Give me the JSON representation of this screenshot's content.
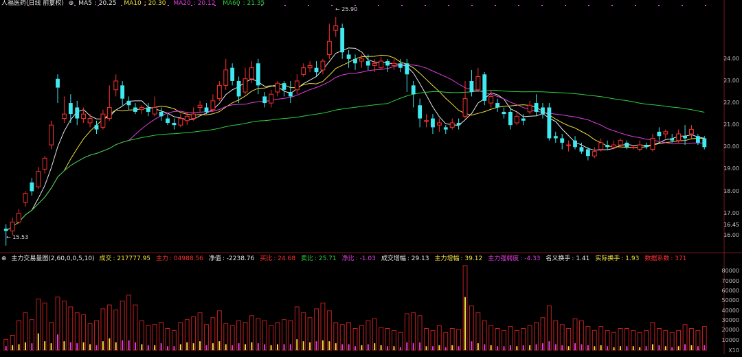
{
  "header": {
    "stock_name": "人福医药(日线 前复权)",
    "ma": [
      {
        "label": "MA5",
        "value": "20.25",
        "color": "#e8e8e8"
      },
      {
        "label": "MA10",
        "value": "20.30",
        "color": "#f0e040"
      },
      {
        "label": "MA20",
        "value": "20.12",
        "color": "#e040e0"
      },
      {
        "label": "MA60",
        "value": "21.35",
        "color": "#30d040"
      }
    ]
  },
  "indicator": {
    "title": "主力交易量图(2,60,0,0,5,10)",
    "items": [
      {
        "label": "成交",
        "value": "217777.95",
        "color": "#f0e040"
      },
      {
        "label": "主力",
        "value": "04988.56",
        "color": "#ff3030"
      },
      {
        "label": "净值",
        "value": "-2238.76",
        "color": "#e8e8e8"
      },
      {
        "label": "买比",
        "value": "24.68",
        "color": "#ff3030"
      },
      {
        "label": "卖比",
        "value": "25.71",
        "color": "#30d040"
      },
      {
        "label": "净比",
        "value": "-1.03",
        "color": "#e040e0"
      },
      {
        "label": "成交增幅",
        "value": "29.13",
        "color": "#e8e8e8"
      },
      {
        "label": "主力增幅",
        "value": "39.12",
        "color": "#f0e040"
      },
      {
        "label": "主力强弱度",
        "value": "-4.33",
        "color": "#e040e0"
      },
      {
        "label": "名义换手",
        "value": "1.41",
        "color": "#e8e8e8"
      },
      {
        "label": "实际换手",
        "value": "1.93",
        "color": "#f0e040"
      },
      {
        "label": "数据系数",
        "value": "371",
        "color": "#ff3030"
      }
    ]
  },
  "price_axis": {
    "ticks": [
      "24.00",
      "23.00",
      "22.00",
      "21.00",
      "20.00",
      "19.00",
      "18.00",
      "17.00",
      "16.00"
    ],
    "current": "16.45"
  },
  "volume_axis": {
    "ticks": [
      "80000",
      "70000",
      "60000",
      "50000",
      "40000",
      "30000",
      "20000",
      "10000"
    ],
    "unit": "X10"
  },
  "annotations": {
    "high": "25.90",
    "low": "15.53"
  },
  "chart_data": {
    "type": "candlestick",
    "title": "人福医药(日线 前复权)",
    "ylim": [
      15.4,
      26.3
    ],
    "volume_ylim": [
      0,
      88000
    ],
    "candles": [
      [
        16.3,
        16.2,
        16.5,
        15.53
      ],
      [
        16.2,
        16.6,
        16.8,
        16.0
      ],
      [
        16.6,
        17.0,
        17.2,
        16.5
      ],
      [
        17.5,
        17.9,
        18.0,
        17.3
      ],
      [
        18.4,
        18.0,
        18.6,
        17.8
      ],
      [
        18.2,
        18.9,
        19.1,
        18.1
      ],
      [
        19.0,
        19.5,
        19.6,
        18.8
      ],
      [
        20.1,
        21.0,
        21.2,
        19.9
      ],
      [
        23.1,
        22.7,
        23.3,
        22.0
      ],
      [
        21.3,
        21.5,
        22.3,
        21.1
      ],
      [
        22.0,
        21.5,
        22.4,
        21.1
      ],
      [
        21.8,
        21.3,
        22.1,
        21.0
      ],
      [
        21.3,
        21.5,
        21.8,
        21.1
      ],
      [
        21.1,
        21.3,
        21.5,
        20.9
      ],
      [
        21.0,
        20.8,
        21.2,
        20.6
      ],
      [
        20.9,
        21.5,
        21.7,
        20.8
      ],
      [
        21.3,
        21.8,
        22.8,
        21.2
      ],
      [
        22.6,
        23.0,
        23.3,
        22.3
      ],
      [
        22.8,
        22.2,
        23.0,
        21.9
      ],
      [
        22.1,
        21.9,
        22.3,
        21.7
      ],
      [
        21.8,
        21.6,
        22.0,
        21.5
      ],
      [
        21.7,
        21.8,
        21.9,
        21.5
      ],
      [
        21.8,
        21.6,
        22.0,
        21.4
      ],
      [
        21.5,
        21.8,
        22.3,
        21.4
      ],
      [
        21.6,
        21.4,
        21.8,
        21.2
      ],
      [
        21.3,
        21.1,
        21.5,
        21.0
      ],
      [
        21.1,
        21.0,
        21.3,
        20.8
      ],
      [
        21.0,
        21.3,
        21.5,
        20.9
      ],
      [
        21.2,
        21.4,
        21.6,
        21.0
      ],
      [
        21.3,
        21.5,
        21.8,
        21.2
      ],
      [
        21.8,
        21.9,
        22.1,
        21.6
      ],
      [
        21.8,
        21.6,
        22.0,
        21.5
      ],
      [
        21.7,
        22.1,
        22.4,
        21.6
      ],
      [
        22.2,
        22.8,
        23.0,
        22.1
      ],
      [
        22.8,
        23.5,
        24.0,
        22.6
      ],
      [
        23.6,
        23.0,
        23.8,
        22.8
      ],
      [
        23.0,
        22.3,
        23.2,
        22.0
      ],
      [
        22.5,
        23.1,
        23.6,
        22.4
      ],
      [
        23.1,
        23.6,
        23.9,
        22.9
      ],
      [
        23.8,
        22.8,
        24.0,
        22.4
      ],
      [
        22.3,
        22.0,
        22.5,
        21.8
      ],
      [
        22.0,
        22.4,
        22.6,
        21.8
      ],
      [
        22.5,
        22.9,
        23.0,
        22.3
      ],
      [
        22.9,
        22.6,
        23.0,
        22.3
      ],
      [
        22.5,
        22.3,
        23.0,
        22.0
      ],
      [
        22.6,
        23.0,
        23.3,
        22.4
      ],
      [
        23.3,
        23.6,
        23.8,
        23.2
      ],
      [
        23.6,
        23.7,
        23.9,
        23.4
      ],
      [
        23.6,
        23.4,
        23.9,
        23.2
      ],
      [
        23.5,
        23.9,
        24.0,
        23.3
      ],
      [
        24.2,
        24.8,
        25.6,
        24.0
      ],
      [
        25.3,
        25.5,
        25.9,
        25.0
      ],
      [
        25.4,
        24.3,
        25.6,
        24.0
      ],
      [
        24.2,
        24.0,
        24.4,
        23.6
      ],
      [
        24.0,
        23.8,
        24.2,
        23.5
      ],
      [
        23.9,
        24.0,
        24.2,
        23.6
      ],
      [
        23.9,
        23.7,
        24.2,
        23.5
      ],
      [
        23.7,
        23.8,
        24.0,
        23.4
      ],
      [
        23.6,
        23.9,
        24.1,
        23.5
      ],
      [
        23.9,
        23.7,
        24.0,
        23.4
      ],
      [
        23.7,
        23.8,
        24.0,
        23.5
      ],
      [
        23.8,
        23.6,
        24.0,
        23.4
      ],
      [
        23.8,
        23.3,
        24.0,
        22.5
      ],
      [
        22.8,
        22.4,
        23.0,
        21.8
      ],
      [
        21.9,
        21.3,
        22.2,
        20.9
      ],
      [
        21.2,
        21.2,
        21.5,
        20.9
      ],
      [
        21.3,
        20.9,
        21.5,
        20.6
      ],
      [
        21.0,
        21.1,
        21.3,
        20.7
      ],
      [
        20.9,
        20.8,
        21.0,
        20.6
      ],
      [
        20.9,
        21.1,
        21.3,
        20.8
      ],
      [
        21.1,
        21.0,
        21.3,
        20.8
      ],
      [
        21.4,
        22.2,
        23.0,
        21.3
      ],
      [
        23.0,
        22.5,
        23.5,
        22.3
      ],
      [
        22.6,
        23.2,
        23.6,
        22.5
      ],
      [
        23.3,
        22.1,
        23.4,
        21.9
      ],
      [
        22.0,
        22.3,
        22.6,
        21.8
      ],
      [
        22.0,
        21.8,
        22.2,
        21.6
      ],
      [
        21.6,
        21.5,
        21.8,
        21.3
      ],
      [
        21.6,
        21.0,
        21.8,
        20.8
      ],
      [
        21.1,
        21.4,
        21.6,
        21.0
      ],
      [
        21.3,
        21.2,
        21.5,
        21.0
      ],
      [
        21.6,
        21.9,
        22.1,
        21.5
      ],
      [
        22.0,
        21.6,
        22.4,
        21.4
      ],
      [
        21.8,
        21.5,
        22.0,
        21.3
      ],
      [
        21.8,
        20.4,
        22.0,
        20.3
      ],
      [
        20.5,
        20.4,
        20.7,
        20.2
      ],
      [
        20.4,
        20.2,
        20.6,
        19.9
      ],
      [
        20.1,
        20.1,
        20.3,
        19.8
      ],
      [
        20.3,
        20.0,
        20.5,
        19.9
      ],
      [
        20.0,
        19.8,
        20.2,
        19.7
      ],
      [
        19.9,
        19.6,
        20.0,
        19.4
      ],
      [
        19.6,
        19.8,
        20.0,
        19.5
      ],
      [
        19.9,
        20.2,
        20.4,
        19.8
      ],
      [
        20.1,
        20.0,
        20.3,
        19.9
      ],
      [
        20.0,
        20.1,
        20.3,
        19.9
      ],
      [
        20.1,
        20.3,
        20.4,
        20.0
      ],
      [
        20.2,
        20.0,
        20.3,
        19.9
      ],
      [
        20.0,
        20.0,
        20.1,
        19.9
      ],
      [
        19.9,
        20.1,
        20.3,
        19.8
      ],
      [
        20.1,
        20.0,
        20.2,
        19.9
      ],
      [
        19.9,
        20.4,
        20.6,
        19.8
      ],
      [
        20.7,
        20.5,
        20.9,
        20.3
      ],
      [
        20.6,
        20.7,
        20.8,
        20.4
      ],
      [
        20.4,
        20.3,
        20.6,
        20.2
      ],
      [
        20.3,
        20.6,
        20.8,
        20.2
      ],
      [
        20.5,
        20.4,
        21.0,
        20.1
      ],
      [
        20.6,
        20.8,
        21.0,
        20.4
      ],
      [
        20.5,
        20.2,
        20.6,
        20.1
      ],
      [
        20.4,
        20.0,
        20.5,
        19.9
      ]
    ],
    "volumes": [
      [
        11000,
        4000
      ],
      [
        15000,
        5000
      ],
      [
        30000,
        6000
      ],
      [
        38000,
        8000
      ],
      [
        31000,
        7000
      ],
      [
        52000,
        17000
      ],
      [
        48000,
        9000
      ],
      [
        28000,
        7000
      ],
      [
        54000,
        16000
      ],
      [
        50000,
        9000
      ],
      [
        44000,
        8000
      ],
      [
        38000,
        7000
      ],
      [
        36000,
        8000
      ],
      [
        27000,
        6000
      ],
      [
        30000,
        5000
      ],
      [
        42000,
        9000
      ],
      [
        46000,
        12000
      ],
      [
        41000,
        8000
      ],
      [
        50000,
        10000
      ],
      [
        56000,
        10000
      ],
      [
        46000,
        8000
      ],
      [
        30000,
        6000
      ],
      [
        25000,
        5000
      ],
      [
        26000,
        5000
      ],
      [
        28000,
        7000
      ],
      [
        22000,
        4000
      ],
      [
        20000,
        4000
      ],
      [
        28000,
        6000
      ],
      [
        31000,
        8000
      ],
      [
        34000,
        7000
      ],
      [
        38000,
        9000
      ],
      [
        26000,
        5000
      ],
      [
        33000,
        7000
      ],
      [
        40000,
        9000
      ],
      [
        27000,
        6000
      ],
      [
        25000,
        5000
      ],
      [
        30000,
        7000
      ],
      [
        28000,
        6000
      ],
      [
        35000,
        8000
      ],
      [
        32000,
        7000
      ],
      [
        30000,
        6000
      ],
      [
        25000,
        5000
      ],
      [
        28000,
        6000
      ],
      [
        31000,
        6000
      ],
      [
        30000,
        6000
      ],
      [
        44000,
        11000
      ],
      [
        38000,
        9000
      ],
      [
        33000,
        8000
      ],
      [
        42000,
        9000
      ],
      [
        48000,
        10000
      ],
      [
        40000,
        9000
      ],
      [
        28000,
        7000
      ],
      [
        26000,
        6000
      ],
      [
        28000,
        6000
      ],
      [
        22000,
        4000
      ],
      [
        25000,
        5000
      ],
      [
        30000,
        6000
      ],
      [
        32000,
        7000
      ],
      [
        23000,
        5000
      ],
      [
        22000,
        4000
      ],
      [
        20000,
        4000
      ],
      [
        18000,
        3000
      ],
      [
        37000,
        8000
      ],
      [
        38000,
        7000
      ],
      [
        35000,
        8000
      ],
      [
        22000,
        4000
      ],
      [
        20000,
        4000
      ],
      [
        25000,
        5000
      ],
      [
        18000,
        3000
      ],
      [
        22000,
        5000
      ],
      [
        21000,
        4000
      ],
      [
        86000,
        54000
      ],
      [
        45000,
        9000
      ],
      [
        38000,
        7000
      ],
      [
        30000,
        6000
      ],
      [
        25000,
        5000
      ],
      [
        22000,
        4000
      ],
      [
        20000,
        4000
      ],
      [
        24000,
        5000
      ],
      [
        20000,
        4000
      ],
      [
        22000,
        5000
      ],
      [
        25000,
        5000
      ],
      [
        28000,
        6000
      ],
      [
        33000,
        7000
      ],
      [
        45000,
        9000
      ],
      [
        30000,
        6000
      ],
      [
        26000,
        5000
      ],
      [
        22000,
        4000
      ],
      [
        32000,
        7000
      ],
      [
        30000,
        6000
      ],
      [
        24000,
        5000
      ],
      [
        20000,
        4000
      ],
      [
        24000,
        5000
      ],
      [
        20000,
        4000
      ],
      [
        18000,
        3000
      ],
      [
        22000,
        4000
      ],
      [
        22000,
        4000
      ],
      [
        20000,
        4000
      ],
      [
        18000,
        3000
      ],
      [
        20000,
        4000
      ],
      [
        28000,
        6000
      ],
      [
        22000,
        5000
      ],
      [
        20000,
        4000
      ],
      [
        18000,
        3000
      ],
      [
        20000,
        4000
      ],
      [
        26000,
        6000
      ],
      [
        22000,
        5000
      ],
      [
        20000,
        4000
      ],
      [
        24000,
        5000
      ]
    ],
    "ma_series": [
      {
        "name": "MA5",
        "color": "#e8e8e8"
      },
      {
        "name": "MA10",
        "color": "#f0e040"
      },
      {
        "name": "MA20",
        "color": "#e040e0"
      },
      {
        "name": "MA60",
        "color": "#30d040"
      }
    ]
  }
}
